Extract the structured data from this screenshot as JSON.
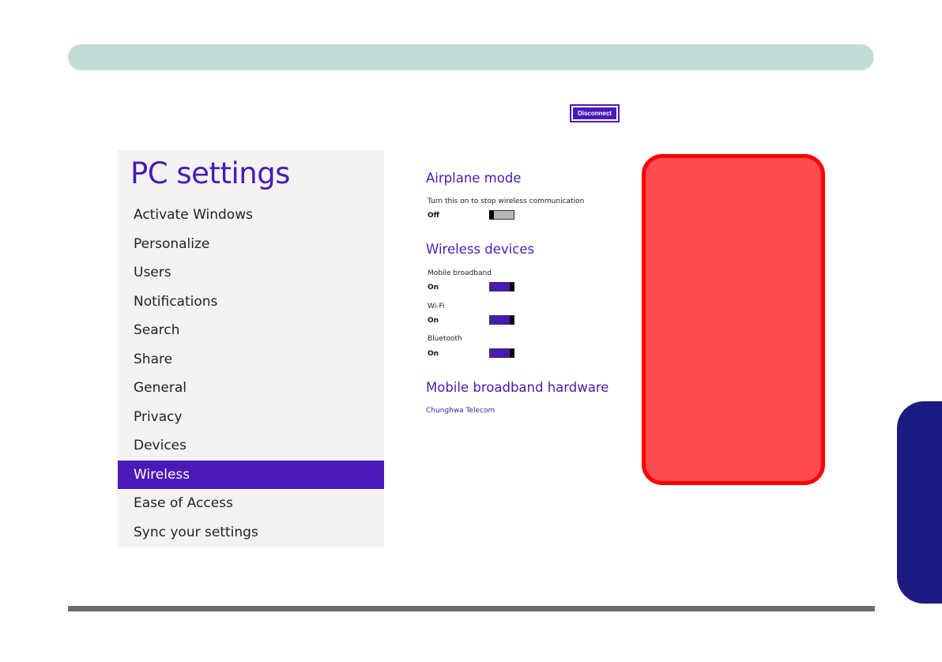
{
  "header": {
    "disconnect_label": "Disconnect"
  },
  "sidebar": {
    "title": "PC settings",
    "items": [
      {
        "label": "Activate Windows",
        "active": false
      },
      {
        "label": "Personalize",
        "active": false
      },
      {
        "label": "Users",
        "active": false
      },
      {
        "label": "Notifications",
        "active": false
      },
      {
        "label": "Search",
        "active": false
      },
      {
        "label": "Share",
        "active": false
      },
      {
        "label": "General",
        "active": false
      },
      {
        "label": "Privacy",
        "active": false
      },
      {
        "label": "Devices",
        "active": false
      },
      {
        "label": "Wireless",
        "active": true
      },
      {
        "label": "Ease of Access",
        "active": false
      },
      {
        "label": "Sync your settings",
        "active": false
      }
    ]
  },
  "airplane_mode": {
    "title": "Airplane mode",
    "description": "Turn this on to stop wireless communication",
    "state": "Off"
  },
  "wireless_devices": {
    "title": "Wireless devices",
    "devices": [
      {
        "label": "Mobile broadband",
        "state": "On"
      },
      {
        "label": "Wi-Fi",
        "state": "On"
      },
      {
        "label": "Bluetooth",
        "state": "On"
      }
    ]
  },
  "mobile_broadband_hardware": {
    "title": "Mobile broadband hardware",
    "carrier": "Chunghwa Telecom"
  },
  "colors": {
    "accent": "#4a19b8",
    "top_bar": "#c4ddd8",
    "redaction": "#ff4a4f",
    "side_tab": "#1a1a80"
  }
}
